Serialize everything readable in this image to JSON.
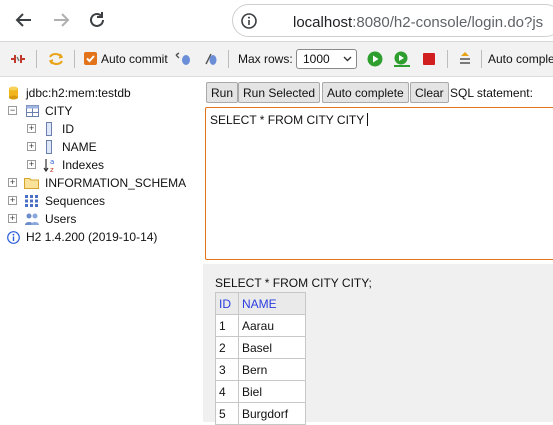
{
  "browser": {
    "url_host": "localhost",
    "url_rest": ":8080/h2-console/login.do?js"
  },
  "toolbar": {
    "auto_commit_label": "Auto commit",
    "max_rows_label": "Max rows:",
    "max_rows_value": "1000",
    "auto_complete_label": "Auto complete",
    "colors": {
      "checkbox": "#e2731b",
      "run": "#2e9e2e",
      "stop": "#d11f1f"
    }
  },
  "tree": {
    "connection": "jdbc:h2:mem:testdb",
    "table": "CITY",
    "columns": [
      "ID",
      "NAME"
    ],
    "indexes": "Indexes",
    "schema": "INFORMATION_SCHEMA",
    "sequences": "Sequences",
    "users": "Users",
    "version": "H2 1.4.200 (2019-10-14)"
  },
  "query": {
    "buttons": [
      "Run",
      "Run Selected",
      "Auto complete",
      "Clear"
    ],
    "sql_label": "SQL statement:",
    "sql_text": "SELECT * FROM CITY CITY"
  },
  "results": {
    "query_text": "SELECT * FROM CITY CITY;",
    "headers": [
      "ID",
      "NAME"
    ],
    "rows": [
      [
        "1",
        "Aarau"
      ],
      [
        "2",
        "Basel"
      ],
      [
        "3",
        "Bern"
      ],
      [
        "4",
        "Biel"
      ],
      [
        "5",
        "Burgdorf"
      ]
    ]
  }
}
